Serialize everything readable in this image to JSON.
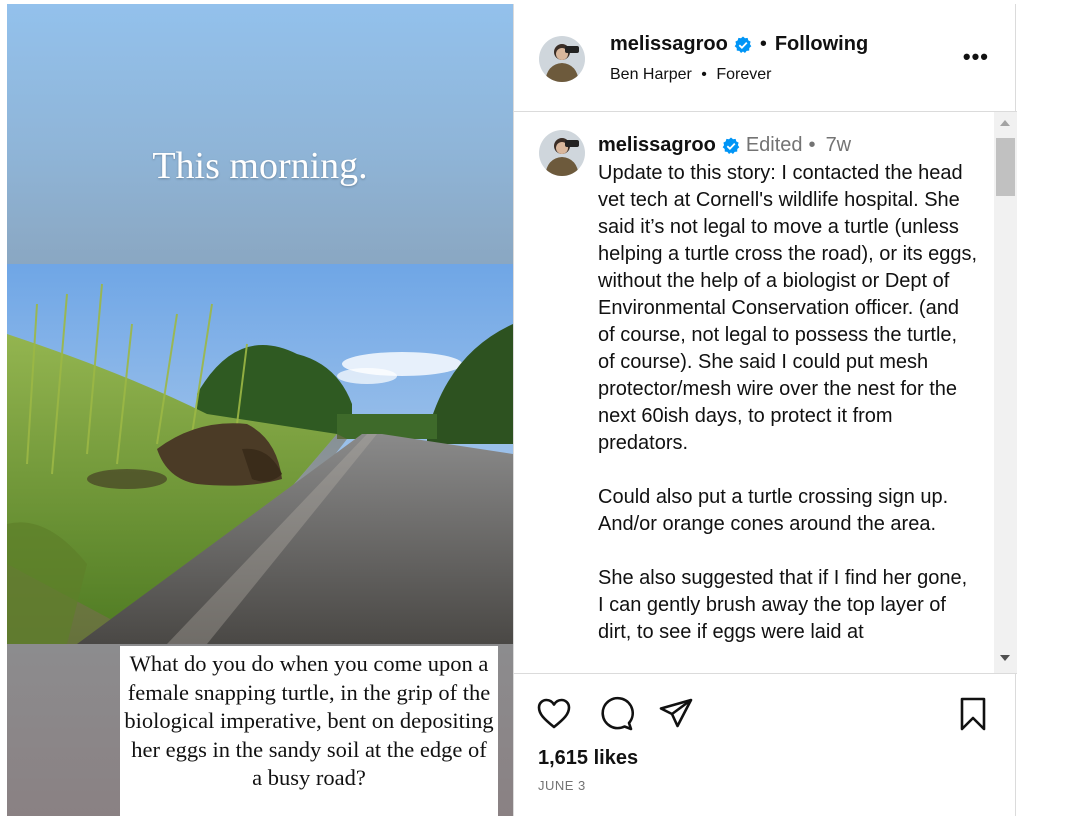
{
  "story": {
    "title_text": "This morning.",
    "caption_text": "What do you do when you come upon a female snapping turtle, in the grip of the biological imperative, bent on depositing her eggs in the sandy soil at the edge of a busy road?"
  },
  "header": {
    "username": "melissagroo",
    "separator": "•",
    "follow_status": "Following",
    "audio_artist": "Ben Harper",
    "audio_track": "Forever",
    "more_label": "•••"
  },
  "comment": {
    "username": "melissagroo",
    "edited_label": "Edited",
    "separator": "•",
    "time_ago": "7w",
    "body": "Update to this story: I contacted the head vet tech at Cornell's wildlife hospital. She said it’s not legal to move a turtle (unless helping a turtle cross the road), or its eggs, without the help of a biologist or Dept of Environmental Conservation officer. (and of course, not legal to possess the turtle, of course). She said I could put mesh protector/mesh wire over the nest for the next 60ish days, to protect it from predators.\n\nCould also put a turtle crossing sign up. And/or orange cones around the area.\n\nShe also suggested that if I find her gone, I can gently brush away the top layer of dirt, to see if eggs were laid at"
  },
  "actions": {
    "icons": [
      "heart-icon",
      "comment-icon",
      "share-icon",
      "bookmark-icon"
    ],
    "likes_text": "1,615 likes",
    "date_text": "JUNE 3"
  },
  "colors": {
    "verified_blue": "#0095f6",
    "divider": "#dbdbdb",
    "muted_text": "#737373"
  }
}
